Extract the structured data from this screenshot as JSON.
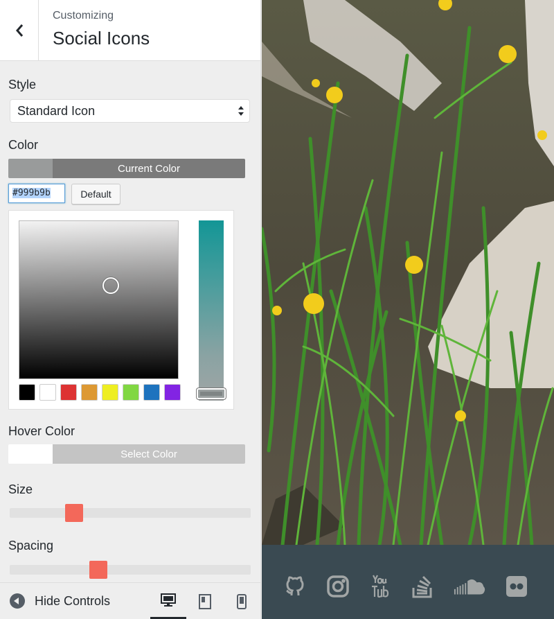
{
  "header": {
    "subtitle": "Customizing",
    "title": "Social Icons"
  },
  "controls": {
    "style": {
      "label": "Style",
      "value": "Standard Icon"
    },
    "color": {
      "label": "Color",
      "button_label": "Current Color",
      "hex_value": "#999b9b",
      "default_label": "Default",
      "current_color": "#999b9b",
      "palette": [
        "#000000",
        "#ffffff",
        "#dd3333",
        "#dd9933",
        "#eeee22",
        "#81d742",
        "#1e73be",
        "#8224e3"
      ]
    },
    "hover_color": {
      "label": "Hover Color",
      "button_label": "Select Color"
    },
    "size": {
      "label": "Size",
      "value_fraction": 0.23
    },
    "spacing": {
      "label": "Spacing",
      "value_fraction": 0.33
    }
  },
  "footer": {
    "hide_controls_label": "Hide Controls",
    "devices": [
      "desktop-icon",
      "tablet-icon",
      "mobile-icon"
    ],
    "active_device": "desktop"
  },
  "preview": {
    "social_icons": [
      "github-icon",
      "instagram-icon",
      "youtube-icon",
      "stackoverflow-icon",
      "soundcloud-icon",
      "flickr-icon"
    ],
    "icon_color": "#999b9b",
    "bar_color": "#3a4a52"
  },
  "colors": {
    "accent_slider": "#f3685a",
    "current_color_bar": "#7a7a7a",
    "hover_color_bar": "#c4c4c4"
  }
}
